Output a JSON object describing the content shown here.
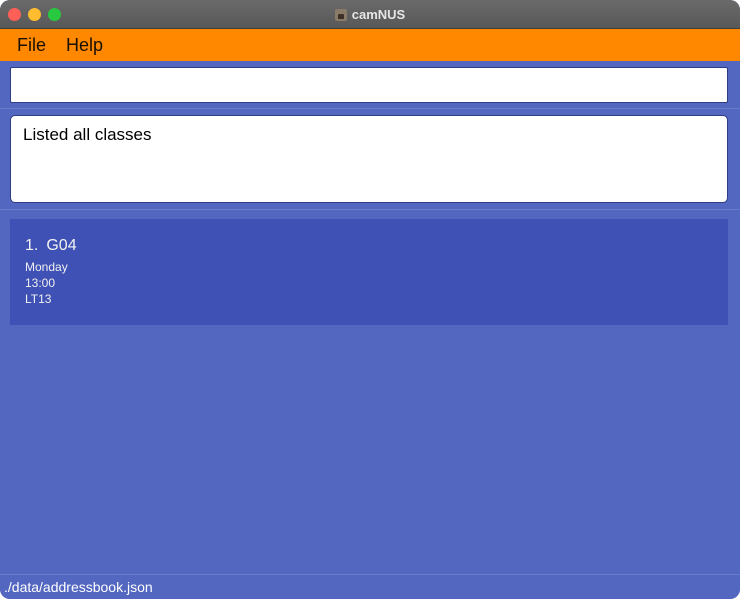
{
  "window": {
    "title": "camNUS"
  },
  "menu": {
    "file": "File",
    "help": "Help"
  },
  "command": {
    "value": ""
  },
  "result": {
    "message": "Listed all classes"
  },
  "classes": [
    {
      "index": "1.",
      "name": "G04",
      "day": "Monday",
      "time": "13:00",
      "venue": "LT13"
    }
  ],
  "status": {
    "path": "./data/addressbook.json"
  },
  "colors": {
    "menubar": "#ff8800",
    "background": "#5366c0",
    "card": "#3f51b5"
  }
}
